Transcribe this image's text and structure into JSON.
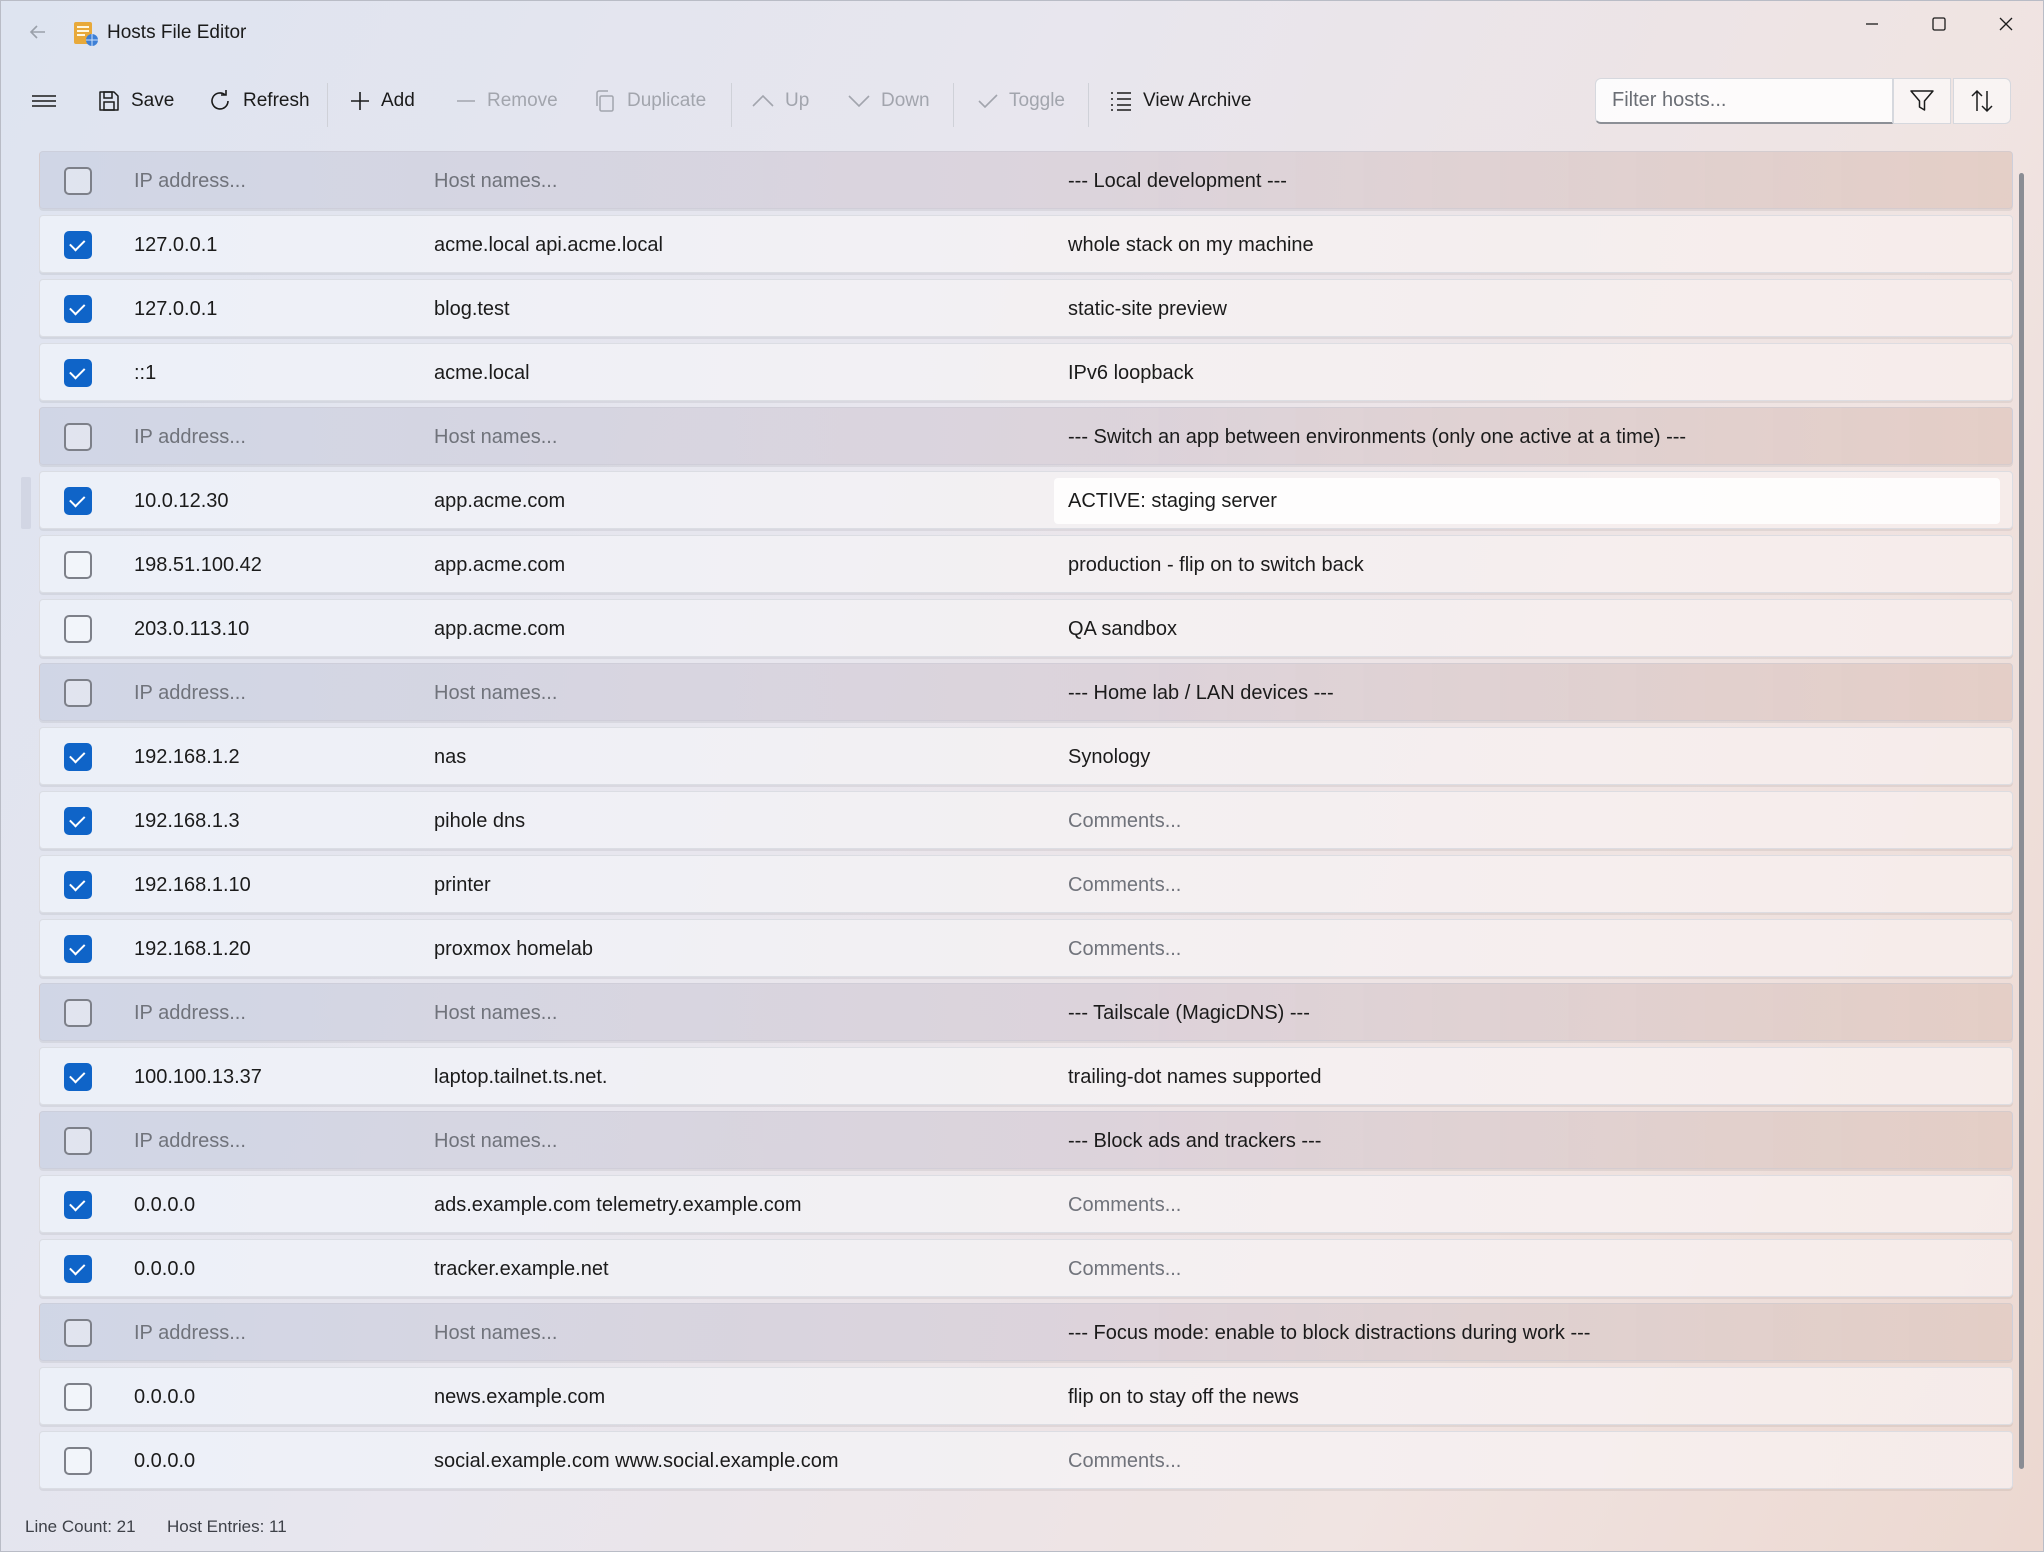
{
  "window": {
    "title": "Hosts File Editor"
  },
  "toolbar": {
    "save": "Save",
    "refresh": "Refresh",
    "add": "Add",
    "remove": "Remove",
    "duplicate": "Duplicate",
    "up": "Up",
    "down": "Down",
    "toggle": "Toggle",
    "view_archive": "View Archive",
    "filter_placeholder": "Filter hosts..."
  },
  "placeholders": {
    "ip": "IP address...",
    "hosts": "Host names...",
    "comment": "Comments..."
  },
  "rows": [
    {
      "type": "comment",
      "checked": false,
      "ip": "",
      "hosts": "",
      "comment": "--- Local development ---"
    },
    {
      "type": "entry",
      "checked": true,
      "ip": "127.0.0.1",
      "hosts": "acme.local api.acme.local",
      "comment": "whole stack on my machine"
    },
    {
      "type": "entry",
      "checked": true,
      "ip": "127.0.0.1",
      "hosts": "blog.test",
      "comment": "static-site preview"
    },
    {
      "type": "entry",
      "checked": true,
      "ip": "::1",
      "hosts": "acme.local",
      "comment": "IPv6 loopback"
    },
    {
      "type": "comment",
      "checked": false,
      "ip": "",
      "hosts": "",
      "comment": "--- Switch an app between environments (only one active at a time) ---"
    },
    {
      "type": "entry",
      "checked": true,
      "ip": "10.0.12.30",
      "hosts": "app.acme.com",
      "comment": "ACTIVE: staging server",
      "focused": true
    },
    {
      "type": "entry",
      "checked": false,
      "ip": "198.51.100.42",
      "hosts": "app.acme.com",
      "comment": "production - flip on to switch back"
    },
    {
      "type": "entry",
      "checked": false,
      "ip": "203.0.113.10",
      "hosts": "app.acme.com",
      "comment": "QA sandbox"
    },
    {
      "type": "comment",
      "checked": false,
      "ip": "",
      "hosts": "",
      "comment": "--- Home lab / LAN devices ---"
    },
    {
      "type": "entry",
      "checked": true,
      "ip": "192.168.1.2",
      "hosts": "nas",
      "comment": "Synology"
    },
    {
      "type": "entry",
      "checked": true,
      "ip": "192.168.1.3",
      "hosts": "pihole dns",
      "comment": ""
    },
    {
      "type": "entry",
      "checked": true,
      "ip": "192.168.1.10",
      "hosts": "printer",
      "comment": ""
    },
    {
      "type": "entry",
      "checked": true,
      "ip": "192.168.1.20",
      "hosts": "proxmox homelab",
      "comment": ""
    },
    {
      "type": "comment",
      "checked": false,
      "ip": "",
      "hosts": "",
      "comment": "--- Tailscale (MagicDNS) ---"
    },
    {
      "type": "entry",
      "checked": true,
      "ip": "100.100.13.37",
      "hosts": "laptop.tailnet.ts.net.",
      "comment": "trailing-dot names supported"
    },
    {
      "type": "comment",
      "checked": false,
      "ip": "",
      "hosts": "",
      "comment": "--- Block ads and trackers ---"
    },
    {
      "type": "entry",
      "checked": true,
      "ip": "0.0.0.0",
      "hosts": "ads.example.com telemetry.example.com",
      "comment": ""
    },
    {
      "type": "entry",
      "checked": true,
      "ip": "0.0.0.0",
      "hosts": "tracker.example.net",
      "comment": ""
    },
    {
      "type": "comment",
      "checked": false,
      "ip": "",
      "hosts": "",
      "comment": "--- Focus mode: enable to block distractions during work ---"
    },
    {
      "type": "entry",
      "checked": false,
      "ip": "0.0.0.0",
      "hosts": "news.example.com",
      "comment": "flip on to stay off the news"
    },
    {
      "type": "entry",
      "checked": false,
      "ip": "0.0.0.0",
      "hosts": "social.example.com www.social.example.com",
      "comment": ""
    }
  ],
  "status": {
    "line_count": "Line Count: 21",
    "host_entries": "Host Entries: 11"
  },
  "colors": {
    "accent": "#0f64c8"
  }
}
